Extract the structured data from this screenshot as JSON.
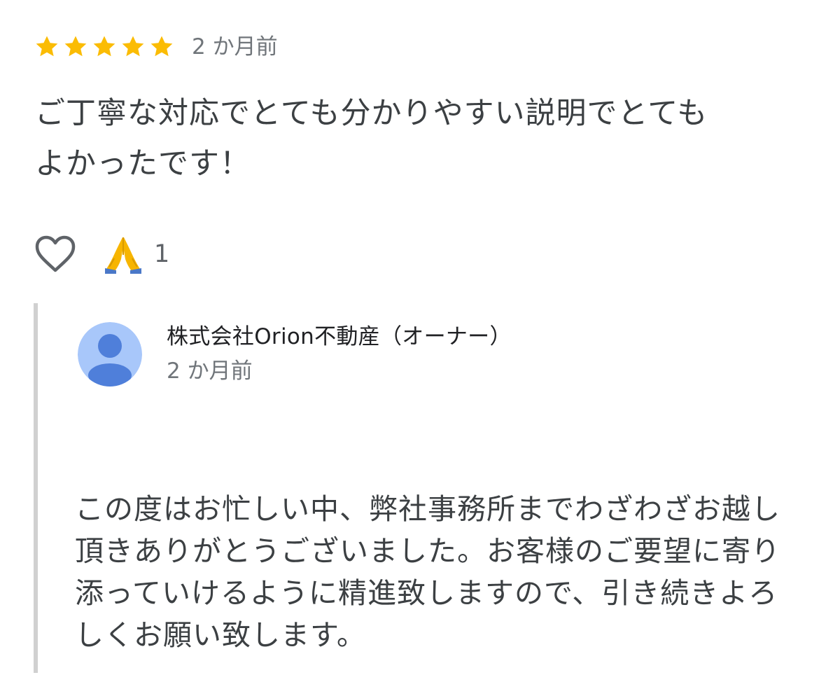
{
  "review": {
    "rating_stars": 5,
    "star_color": "#fbbc04",
    "date": "2 か月前",
    "text": "ご丁寧な対応でとても分かりやすい説明でとても\nよかったです！"
  },
  "reactions": {
    "like_icon": "heart-outline-icon",
    "reaction_icon": "folded-hands-icon",
    "reaction_count": "1"
  },
  "owner_reply": {
    "owner_name": "株式会社Orion不動産（オーナー）",
    "date": "2 か月前",
    "avatar_icon": "person-avatar-icon",
    "avatar_bg_color": "#a8c7fa",
    "avatar_fg_color": "#4f7fda",
    "text": "この度はお忙しい中、弊社事務所までわざわざお越し\n頂きありがとうございました。お客様のご要望に寄り\n添っていけるように精進致しますので、引き続きよろ\nしくお願い致します。"
  },
  "colors": {
    "text_primary": "#3c4043",
    "text_secondary": "#70757a",
    "divider": "#d0d0d0"
  }
}
